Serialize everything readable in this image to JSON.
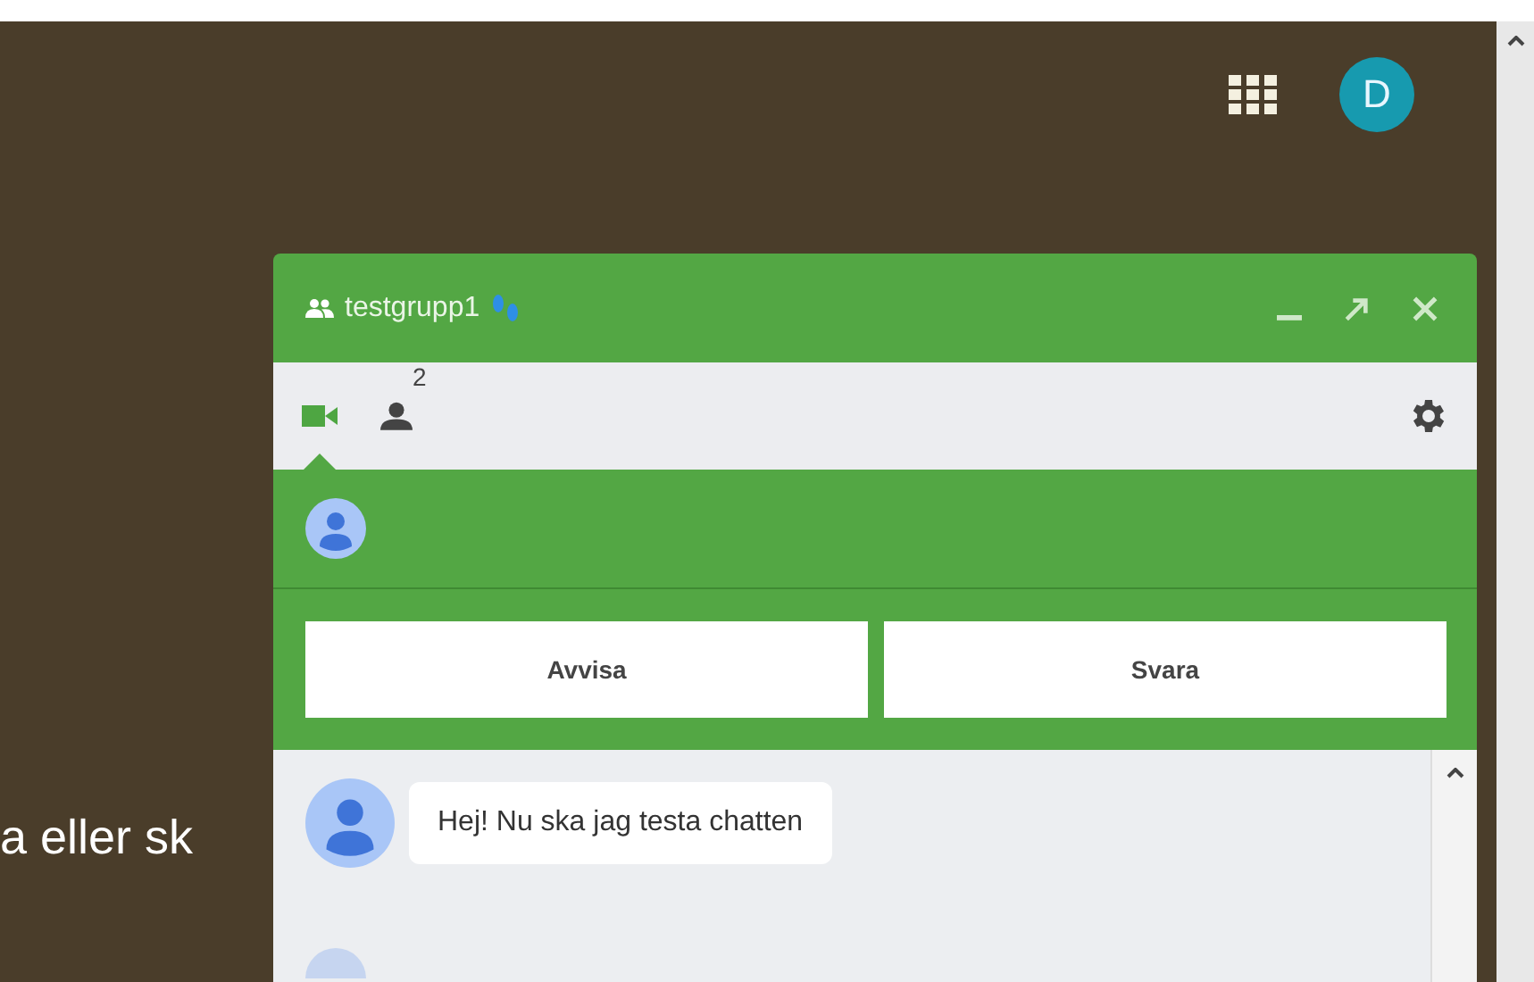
{
  "page": {
    "background_text": "a eller sk",
    "account_initial": "D"
  },
  "chat": {
    "title": "testgrupp1",
    "tabs": [
      {
        "kind": "video",
        "selected": true
      },
      {
        "kind": "people",
        "count": "2",
        "selected": false
      }
    ],
    "call": {
      "buttons": [
        "Avvisa",
        "Svara"
      ]
    },
    "messages": [
      {
        "text": "Hej! Nu ska jag testa chatten"
      }
    ]
  }
}
